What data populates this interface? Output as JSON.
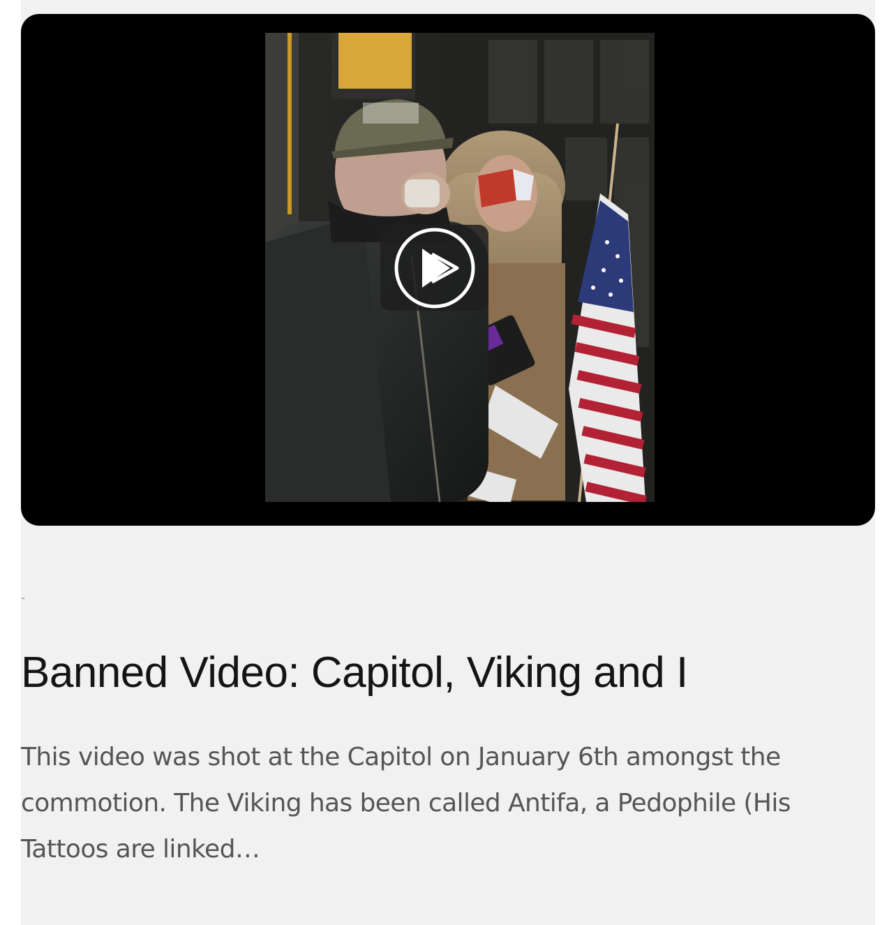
{
  "video": {
    "thumbnail_alt": "Two men at the Capitol doors, one speaking into a phone, one in a fur headdress with face paint holding an American flag",
    "play_icon": "play-icon"
  },
  "article": {
    "meta": "-",
    "title": "Banned Video: Capitol, Viking and I",
    "excerpt": "This video was shot at the Capitol on January 6th amongst the commotion. The Viking has been called Antifa, a Pedophile (His Tattoos are linked…"
  },
  "colors": {
    "background": "#f1f1f1",
    "title": "#141414",
    "excerpt": "#555555",
    "player": "#000000"
  }
}
